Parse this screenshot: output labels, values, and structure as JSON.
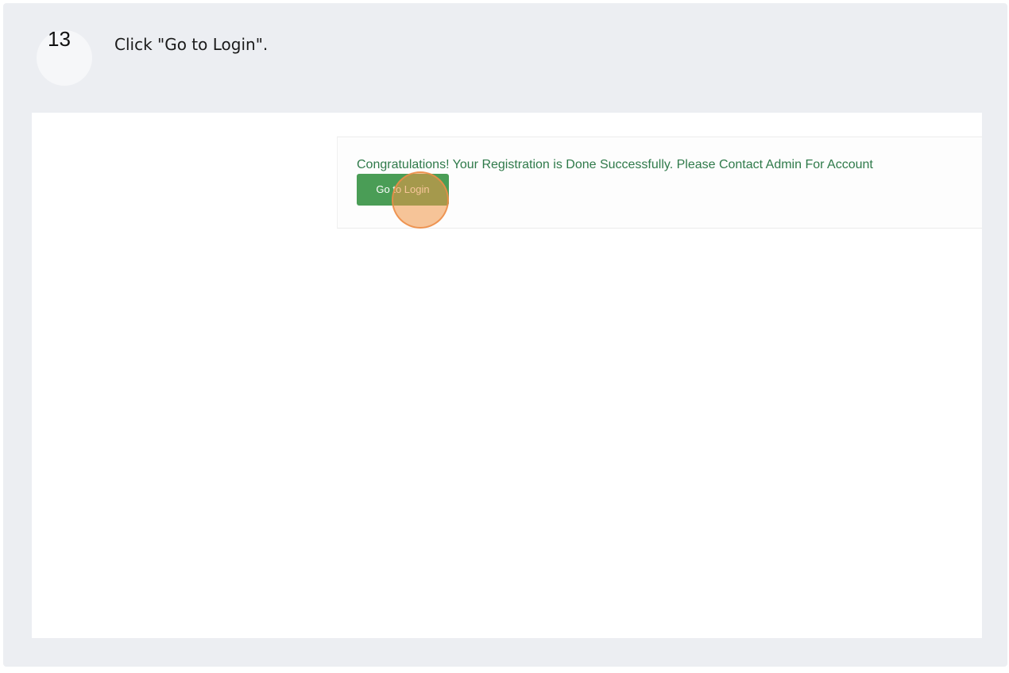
{
  "step": {
    "number": "13",
    "instruction": "Click \"Go to Login\"."
  },
  "screenshot": {
    "message": "Congratulations! Your Registration is Done Successfully. Please Contact Admin For Account",
    "button_label": "Go to Login"
  },
  "colors": {
    "button": "#4a9d56",
    "message_text": "#2f7a4a",
    "click_highlight": "#f09646"
  }
}
